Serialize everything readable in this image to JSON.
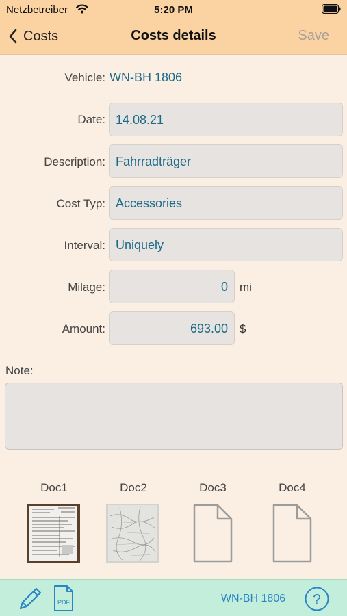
{
  "status_bar": {
    "carrier": "Netzbetreiber",
    "time": "5:20 PM"
  },
  "nav": {
    "back_label": "Costs",
    "title": "Costs details",
    "save_label": "Save"
  },
  "form": {
    "vehicle": {
      "label": "Vehicle:",
      "value": "WN-BH 1806"
    },
    "date": {
      "label": "Date:",
      "value": "14.08.21"
    },
    "description": {
      "label": "Description:",
      "value": "Fahrradträger"
    },
    "cost_type": {
      "label": "Cost Typ:",
      "value": "Accessories"
    },
    "interval": {
      "label": "Interval:",
      "value": "Uniquely"
    },
    "mileage": {
      "label": "Milage:",
      "value": "0",
      "unit": "mi"
    },
    "amount": {
      "label": "Amount:",
      "value": "693.00",
      "unit": "$"
    },
    "note": {
      "label": "Note:",
      "value": ""
    }
  },
  "documents": [
    {
      "label": "Doc1",
      "state": "receipt-scan"
    },
    {
      "label": "Doc2",
      "state": "receipt-scan"
    },
    {
      "label": "Doc3",
      "state": "empty"
    },
    {
      "label": "Doc4",
      "state": "empty"
    }
  ],
  "bottom_bar": {
    "vehicle": "WN-BH 1806",
    "pdf_icon_text": "PDF"
  },
  "colors": {
    "header_bg": "#fbd2a2",
    "page_bg": "#fbefe3",
    "field_bg": "#e6e3e0",
    "value_text": "#1b6a88",
    "bottom_bar_bg": "#c3eedb",
    "bottom_icon": "#2a85c4"
  },
  "icons": [
    "wifi-icon",
    "battery-icon",
    "chevron-left-icon",
    "pencil-icon",
    "pdf-file-icon",
    "help-icon",
    "document-icon"
  ]
}
